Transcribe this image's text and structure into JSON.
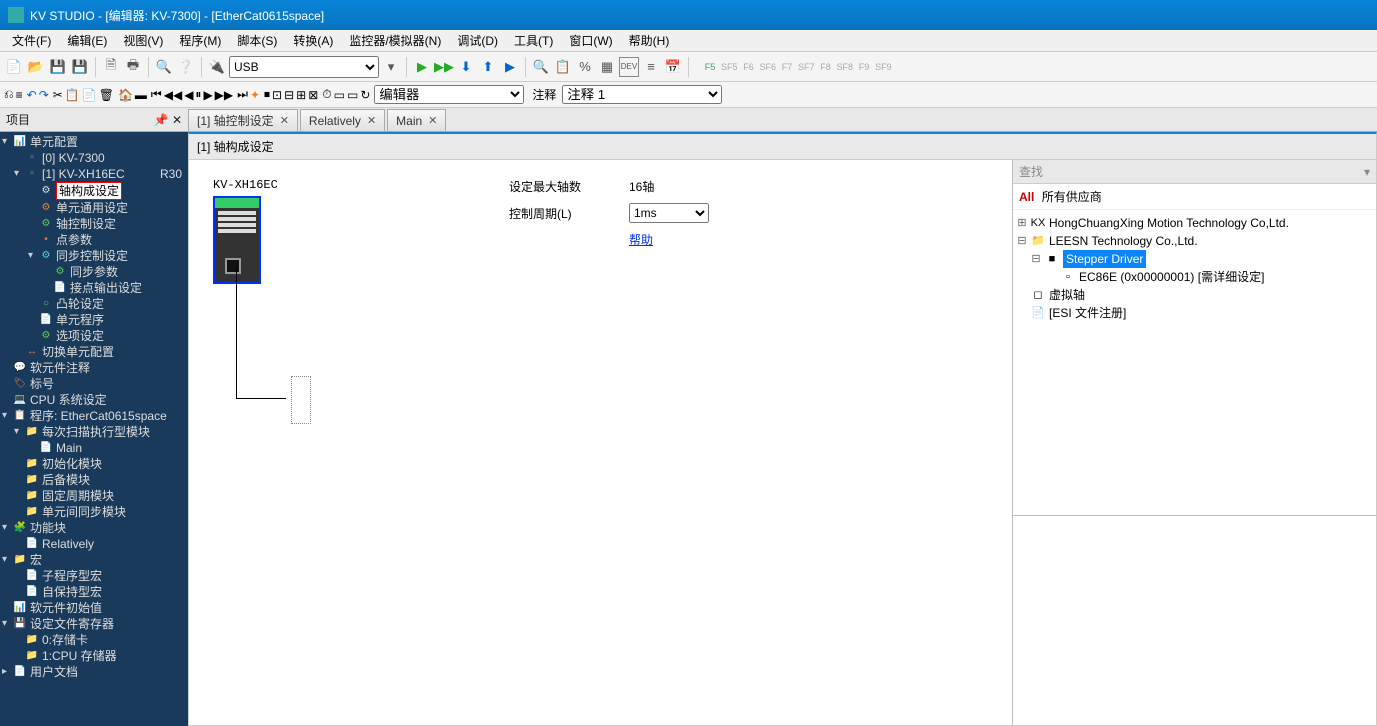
{
  "title": "KV STUDIO - [编辑器: KV-7300] - [EtherCat0615space]",
  "menu": [
    "文件(F)",
    "编辑(E)",
    "视图(V)",
    "程序(M)",
    "脚本(S)",
    "转换(A)",
    "监控器/模拟器(N)",
    "调试(D)",
    "工具(T)",
    "窗口(W)",
    "帮助(H)"
  ],
  "toolbar": {
    "usb_dropdown": "USB",
    "mode_dropdown": "编辑器",
    "comment_label": "注释",
    "comment_dropdown": "注释 1"
  },
  "sf_labels": [
    "F5",
    "SF5",
    "F6",
    "SF6",
    "F7",
    "SF7",
    "F8",
    "SF8",
    "F9",
    "SF9"
  ],
  "sidebar_title": "项目",
  "tree": [
    {
      "depth": 0,
      "tw": "▾",
      "icon": "📊",
      "iconClass": "ic-cyan",
      "label": "单元配置"
    },
    {
      "depth": 1,
      "tw": "",
      "icon": "▫",
      "iconClass": "folder-blue",
      "label": "[0]  KV-7300"
    },
    {
      "depth": 1,
      "tw": "▾",
      "icon": "▫",
      "iconClass": "folder-blue",
      "label": "[1]  KV-XH16EC",
      "suffix": "R30"
    },
    {
      "depth": 2,
      "tw": "",
      "icon": "⚙",
      "iconClass": "",
      "label": "轴构成设定",
      "hl": true
    },
    {
      "depth": 2,
      "tw": "",
      "icon": "⚙",
      "iconClass": "folder-orange",
      "label": "单元通用设定"
    },
    {
      "depth": 2,
      "tw": "",
      "icon": "⚙",
      "iconClass": "ic-green",
      "label": "轴控制设定"
    },
    {
      "depth": 2,
      "tw": "",
      "icon": "•",
      "iconClass": "folder-orange",
      "label": "点参数"
    },
    {
      "depth": 2,
      "tw": "▾",
      "icon": "⚙",
      "iconClass": "ic-cyan",
      "label": "同步控制设定"
    },
    {
      "depth": 3,
      "tw": "",
      "icon": "⚙",
      "iconClass": "ic-green",
      "label": "同步参数"
    },
    {
      "depth": 3,
      "tw": "",
      "icon": "📄",
      "iconClass": "",
      "label": "接点输出设定"
    },
    {
      "depth": 2,
      "tw": "",
      "icon": "○",
      "iconClass": "ic-green",
      "label": "凸轮设定"
    },
    {
      "depth": 2,
      "tw": "",
      "icon": "📄",
      "iconClass": "",
      "label": "单元程序"
    },
    {
      "depth": 2,
      "tw": "",
      "icon": "⚙",
      "iconClass": "ic-green",
      "label": "选项设定"
    },
    {
      "depth": 1,
      "tw": "",
      "icon": "↔",
      "iconClass": "folder-orange",
      "label": "切换单元配置"
    },
    {
      "depth": 0,
      "tw": "",
      "icon": "💬",
      "iconClass": "ic-cyan",
      "label": "软元件注释"
    },
    {
      "depth": 0,
      "tw": "",
      "icon": "🏷",
      "iconClass": "folder-orange",
      "label": "标号"
    },
    {
      "depth": 0,
      "tw": "",
      "icon": "💻",
      "iconClass": "ic-cyan",
      "label": "CPU 系统设定"
    },
    {
      "depth": 0,
      "tw": "▾",
      "icon": "📋",
      "iconClass": "folder-orange",
      "label": "程序: EtherCat0615space"
    },
    {
      "depth": 1,
      "tw": "▾",
      "icon": "📁",
      "iconClass": "folder-yellow",
      "label": "每次扫描执行型模块"
    },
    {
      "depth": 2,
      "tw": "",
      "icon": "📄",
      "iconClass": "",
      "label": "Main"
    },
    {
      "depth": 1,
      "tw": "",
      "icon": "📁",
      "iconClass": "folder-yellow",
      "label": "初始化模块"
    },
    {
      "depth": 1,
      "tw": "",
      "icon": "📁",
      "iconClass": "folder-yellow",
      "label": "后备模块"
    },
    {
      "depth": 1,
      "tw": "",
      "icon": "📁",
      "iconClass": "folder-yellow",
      "label": "固定周期模块"
    },
    {
      "depth": 1,
      "tw": "",
      "icon": "📁",
      "iconClass": "folder-yellow",
      "label": "单元间同步模块"
    },
    {
      "depth": 0,
      "tw": "▾",
      "icon": "🧩",
      "iconClass": "ic-cyan",
      "label": "功能块"
    },
    {
      "depth": 1,
      "tw": "",
      "icon": "📄",
      "iconClass": "",
      "label": "Relatively"
    },
    {
      "depth": 0,
      "tw": "▾",
      "icon": "📁",
      "iconClass": "ic-cyan",
      "label": "宏"
    },
    {
      "depth": 1,
      "tw": "",
      "icon": "📄",
      "iconClass": "ic-green",
      "label": "子程序型宏"
    },
    {
      "depth": 1,
      "tw": "",
      "icon": "📄",
      "iconClass": "ic-green",
      "label": "自保持型宏"
    },
    {
      "depth": 0,
      "tw": "",
      "icon": "📊",
      "iconClass": "",
      "label": "软元件初始值"
    },
    {
      "depth": 0,
      "tw": "▾",
      "icon": "💾",
      "iconClass": "ic-cyan",
      "label": "设定文件寄存器"
    },
    {
      "depth": 1,
      "tw": "",
      "icon": "📁",
      "iconClass": "folder-yellow",
      "label": "0:存储卡"
    },
    {
      "depth": 1,
      "tw": "",
      "icon": "📁",
      "iconClass": "folder-yellow",
      "label": "1:CPU 存储器"
    },
    {
      "depth": 0,
      "tw": "▸",
      "icon": "📄",
      "iconClass": "",
      "label": "用户文档"
    }
  ],
  "tabs": [
    {
      "label": "[1] 轴控制设定",
      "active": false
    },
    {
      "label": "Relatively",
      "active": false
    },
    {
      "label": "Main",
      "active": false
    }
  ],
  "doc_header": "[1] 轴构成设定",
  "device_name": "KV-XH16EC",
  "params": {
    "max_axes_label": "设定最大轴数",
    "max_axes_value": "16轴",
    "cycle_label": "控制周期(L)",
    "cycle_value": "1ms",
    "help": "帮助"
  },
  "right_panel": {
    "search": "查找",
    "all_label": "All",
    "all_text": "所有供应商",
    "vendors": [
      {
        "depth": 0,
        "tw": "⊞",
        "icon": "KX",
        "label": "HongChuangXing Motion Technology Co,Ltd."
      },
      {
        "depth": 0,
        "tw": "⊟",
        "icon": "📁",
        "label": "LEESN Technology Co.,Ltd."
      },
      {
        "depth": 1,
        "tw": "⊟",
        "icon": "■",
        "label": "Stepper Driver",
        "selected": true
      },
      {
        "depth": 2,
        "tw": "",
        "icon": "▫",
        "label": "EC86E (0x00000001) [需详细设定]"
      },
      {
        "depth": 0,
        "tw": "",
        "icon": "◻",
        "label": "虚拟轴"
      },
      {
        "depth": 0,
        "tw": "",
        "icon": "📄",
        "label": "[ESI 文件注册]"
      }
    ]
  }
}
